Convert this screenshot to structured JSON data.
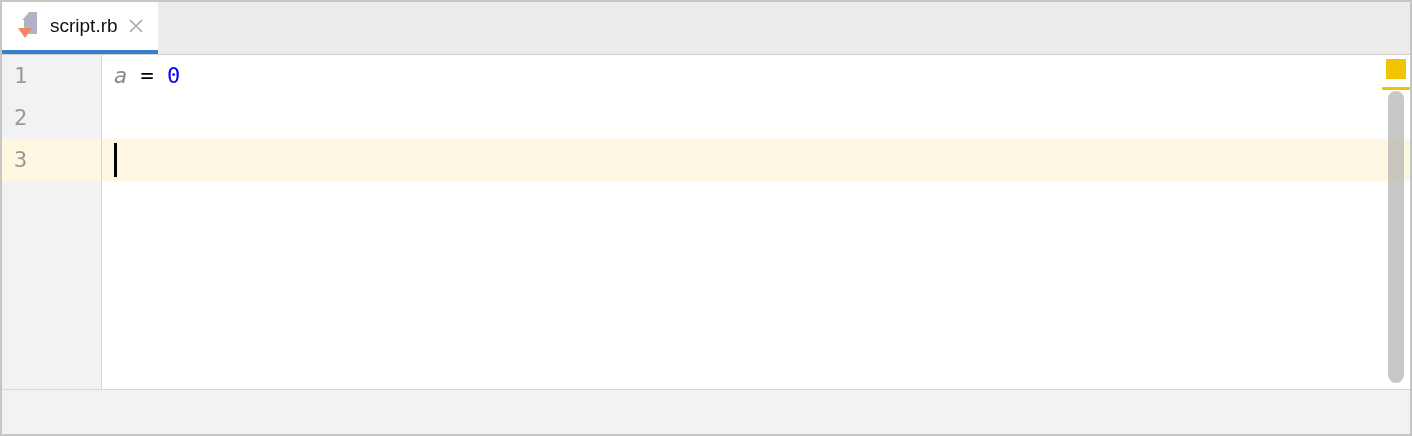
{
  "tabs": [
    {
      "label": "script.rb",
      "selected": true
    }
  ],
  "lines": [
    {
      "number": "1",
      "current": false,
      "tokens": [
        {
          "text": "a",
          "kind": "variable"
        },
        {
          "text": " = ",
          "kind": "operator"
        },
        {
          "text": "0",
          "kind": "number"
        }
      ]
    },
    {
      "number": "2",
      "current": false
    },
    {
      "number": "3",
      "current": true
    }
  ]
}
